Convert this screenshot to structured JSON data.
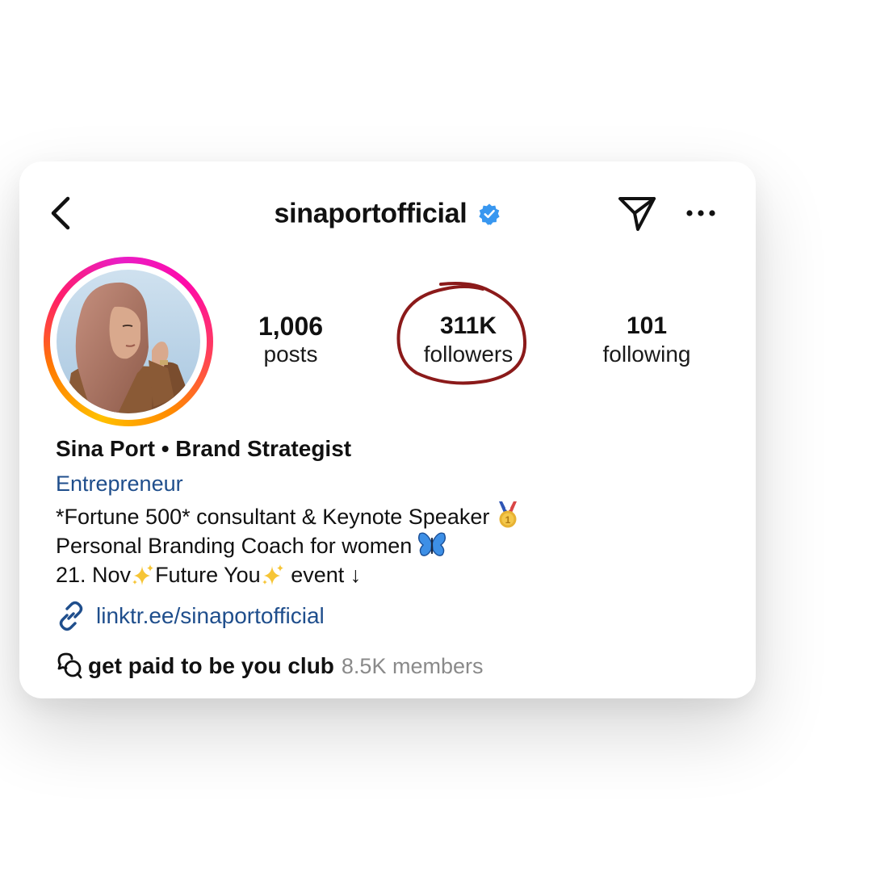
{
  "header": {
    "username": "sinaportofficial",
    "verified_icon": "verified-badge-icon",
    "back_icon": "chevron-left-icon",
    "send_icon": "paper-plane-icon",
    "more_icon": "ellipsis-icon"
  },
  "avatar": {
    "icon": "profile-photo"
  },
  "stats": {
    "posts_count": "1,006",
    "posts_label": "posts",
    "followers_count": "311K",
    "followers_label": "followers",
    "following_count": "101",
    "following_label": "following"
  },
  "bio": {
    "name": "Sina Port • Brand Strategist",
    "category": "Entrepreneur",
    "line1_text": "*Fortune 500* consultant & Keynote Speaker",
    "line2_text": "Personal Branding Coach for women",
    "line3_part1": "21. Nov",
    "line3_part2": "Future You",
    "line3_part3": " event ↓",
    "link": "linktr.ee/sinaportofficial",
    "link_icon": "link-icon"
  },
  "club": {
    "icon": "chat-bubbles-icon",
    "name": "get paid to be you club",
    "members": "8.5K members"
  },
  "colors": {
    "accent_link": "#1f4e8c",
    "verified_blue": "#3897f0",
    "annotation_red": "#8b1a1a",
    "ring_gradient": [
      "#ffc000",
      "#ff7a00",
      "#ff1d6b",
      "#e91ec6"
    ]
  }
}
